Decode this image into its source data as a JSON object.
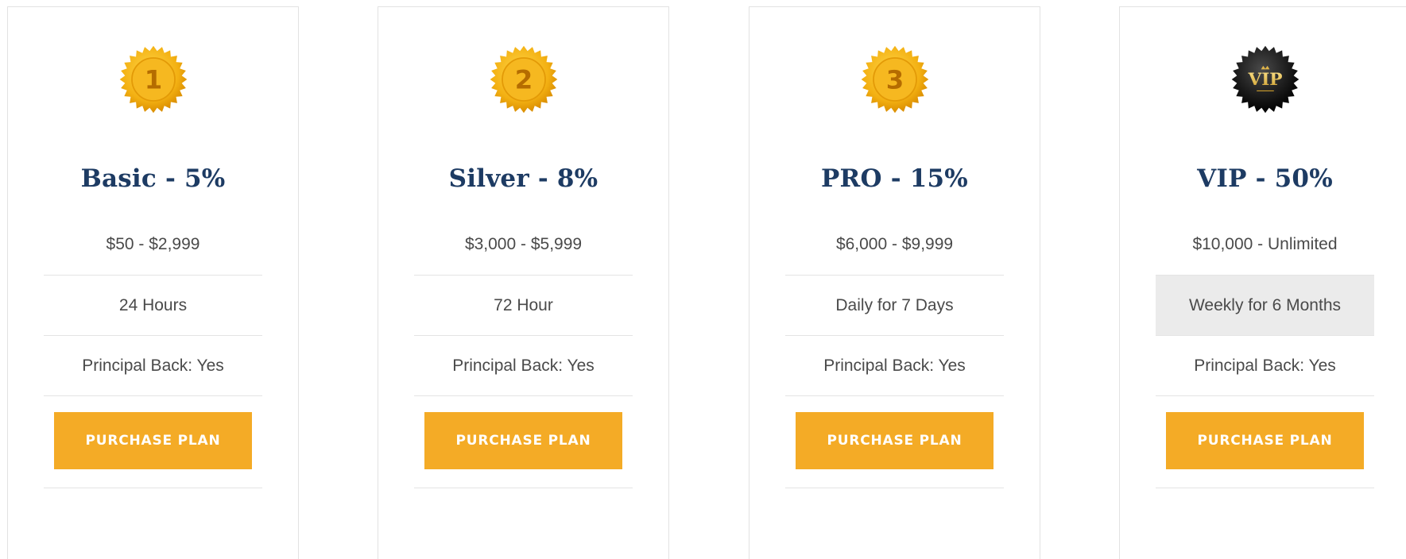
{
  "colors": {
    "title": "#1d3b63",
    "button_bg": "#f4ab26",
    "button_text": "#ffffff",
    "gold_medal": "#f3b012",
    "vip_badge": "#1c1c1c",
    "highlight_row": "#ebebeb"
  },
  "plans": [
    {
      "badge_icon": "gold-medal-1-icon",
      "badge_text": "1",
      "title": "Basic - 5%",
      "range": "$50 - $2,999",
      "term": "24 Hours",
      "principal": "Principal Back: Yes",
      "button_label": "PURCHASE PLAN"
    },
    {
      "badge_icon": "gold-medal-2-icon",
      "badge_text": "2",
      "title": "Silver - 8%",
      "range": "$3,000 - $5,999",
      "term": "72 Hour",
      "principal": "Principal Back: Yes",
      "button_label": "PURCHASE PLAN"
    },
    {
      "badge_icon": "gold-medal-3-icon",
      "badge_text": "3",
      "title": "PRO - 15%",
      "range": "$6,000 - $9,999",
      "term": "Daily for 7 Days",
      "principal": "Principal Back: Yes",
      "button_label": "PURCHASE PLAN"
    },
    {
      "badge_icon": "vip-badge-icon",
      "badge_text": "VIP",
      "title": "VIP - 50%",
      "range": "$10,000 - Unlimited",
      "term": "Weekly for 6 Months",
      "principal": "Principal Back: Yes",
      "button_label": "PURCHASE PLAN"
    }
  ]
}
